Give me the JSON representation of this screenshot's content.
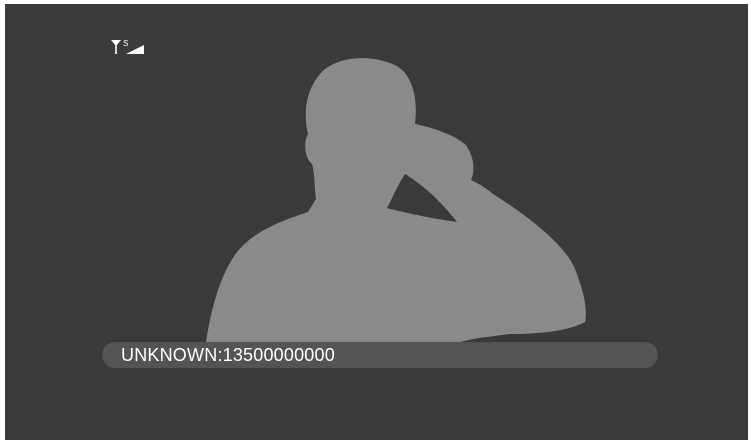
{
  "status_bar": {
    "signal_icon": "signal-strength-icon",
    "signal_label": "S"
  },
  "caller": {
    "name": "UNKNOWN",
    "separator": " : ",
    "number": "13500000000",
    "avatar_icon": "caller-silhouette-icon"
  },
  "colors": {
    "screen_bg": "#3a3a3a",
    "silhouette": "#8a8a8a",
    "caller_bar": "#545454",
    "text": "#ffffff"
  }
}
